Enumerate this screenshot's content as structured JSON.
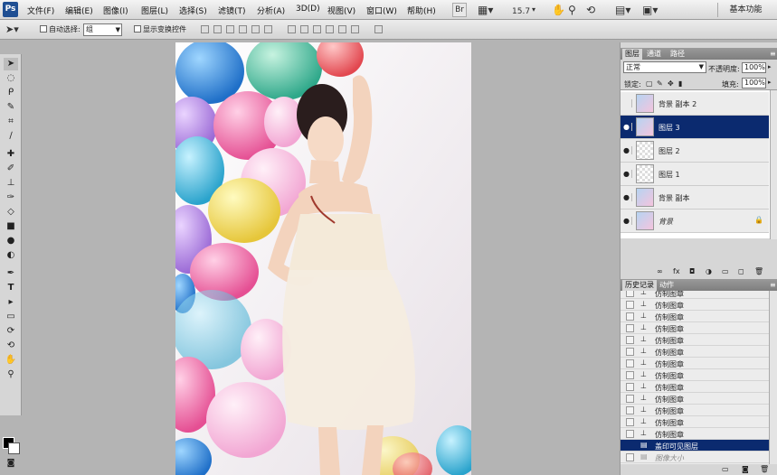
{
  "menubar": {
    "logo": "Ps",
    "items": [
      "文件(F)",
      "编辑(E)",
      "图像(I)",
      "图层(L)",
      "选择(S)",
      "滤镜(T)",
      "分析(A)",
      "3D(D)",
      "视图(V)",
      "窗口(W)",
      "帮助(H)"
    ],
    "br_button": "Br",
    "zoom": "15.7",
    "workspace": "基本功能"
  },
  "options": {
    "auto_select": "自动选择:",
    "auto_select_value": "组",
    "show_transform": "显示变换控件"
  },
  "canvas": {
    "colors": {
      "bg": "#f2eef0"
    }
  },
  "layers_panel": {
    "tabs": [
      "图层",
      "通道",
      "路径"
    ],
    "blend_mode": "正常",
    "opacity_label": "不透明度:",
    "opacity_value": "100%",
    "lock_label": "锁定:",
    "fill_label": "填充:",
    "fill_value": "100%",
    "layers": [
      {
        "name": "背景 副本 2",
        "visible": false,
        "selected": false
      },
      {
        "name": "图层 3",
        "visible": true,
        "selected": true
      },
      {
        "name": "图层 2",
        "visible": true,
        "selected": false
      },
      {
        "name": "图层 1",
        "visible": true,
        "selected": false
      },
      {
        "name": "背景 副本",
        "visible": true,
        "selected": false
      },
      {
        "name": "背景",
        "visible": true,
        "selected": false,
        "locked": true
      }
    ]
  },
  "history_panel": {
    "tabs": [
      "历史记录",
      "动作"
    ],
    "items": [
      {
        "name": "仿制图章"
      },
      {
        "name": "仿制图章"
      },
      {
        "name": "仿制图章"
      },
      {
        "name": "仿制图章"
      },
      {
        "name": "仿制图章"
      },
      {
        "name": "仿制图章"
      },
      {
        "name": "仿制图章"
      },
      {
        "name": "仿制图章"
      },
      {
        "name": "仿制图章"
      },
      {
        "name": "仿制图章"
      },
      {
        "name": "仿制图章"
      },
      {
        "name": "仿制图章"
      },
      {
        "name": "仿制图章"
      },
      {
        "name": "盖印可见图层",
        "selected": true
      },
      {
        "name": "图像大小",
        "dim": true
      }
    ]
  }
}
